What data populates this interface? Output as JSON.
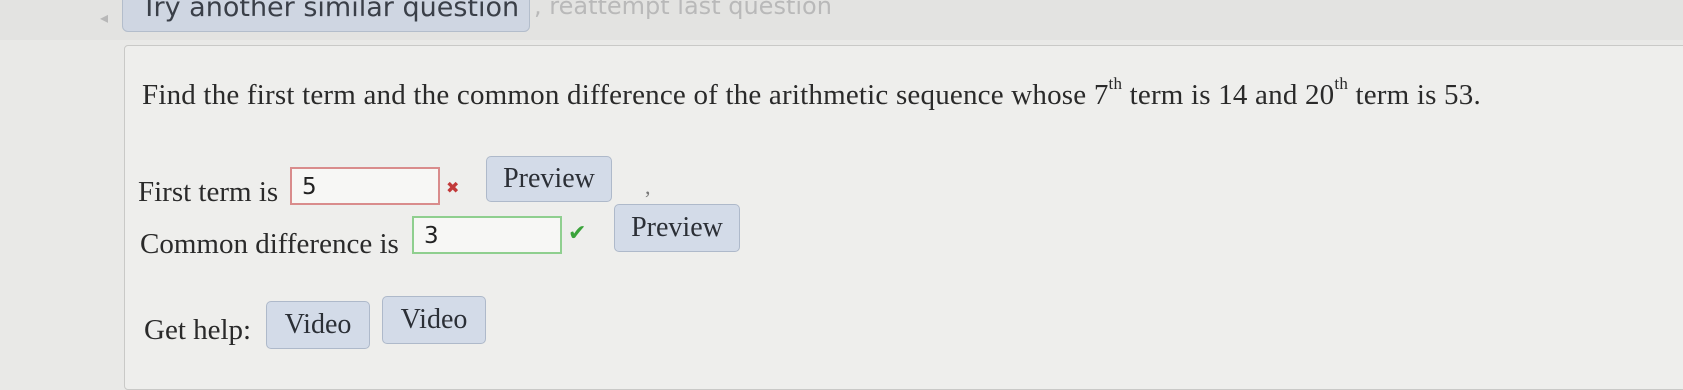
{
  "nav": {
    "back_icon": "left-arrow-icon",
    "try_another": "Try another similar question",
    "reattempt": ", reattempt last question"
  },
  "question": {
    "part1": "Find the first term and the common difference of the arithmetic sequence whose",
    "n1": "7",
    "sup1": "th",
    "part2": "term is 14 and",
    "n2": "20",
    "sup2": "th",
    "part3": "term is 53."
  },
  "first_term": {
    "label": "First term is",
    "value": "5",
    "status": "incorrect",
    "status_icon": "x-icon",
    "preview_label": "Preview"
  },
  "separator": ",",
  "common_difference": {
    "label": "Common difference is",
    "value": "3",
    "status": "correct",
    "status_icon": "check-icon",
    "preview_label": "Preview"
  },
  "help": {
    "label": "Get help:",
    "buttons": [
      "Video",
      "Video"
    ]
  },
  "colors": {
    "wrong_border": "#d98c8c",
    "right_border": "#8fcf8f",
    "button_bg": "#d3dbe8"
  }
}
